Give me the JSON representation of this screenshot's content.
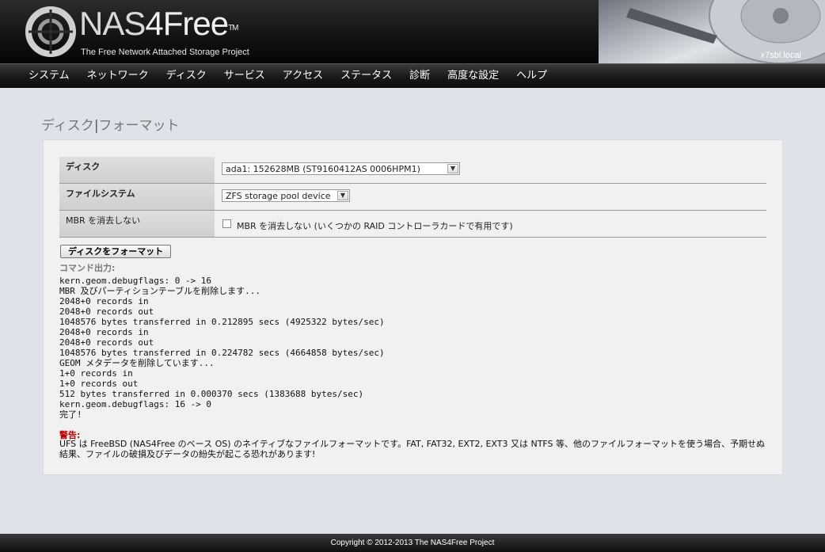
{
  "header": {
    "brand_nas": "NAS",
    "brand_rest": "4Free",
    "trademark": "TM",
    "tagline": "The Free Network Attached Storage Project",
    "hostname": "x7sbl.local"
  },
  "nav": {
    "items": [
      "システム",
      "ネットワーク",
      "ディスク",
      "サービス",
      "アクセス",
      "ステータス",
      "診断",
      "高度な設定",
      "ヘルプ"
    ]
  },
  "page": {
    "title_section": "ディスク",
    "title_separator": "|",
    "title_page": "フォーマット"
  },
  "form": {
    "disk_label": "ディスク",
    "disk_value": "ada1: 152628MB (ST9160412AS 0006HPM1)",
    "fs_label": "ファイルシステム",
    "fs_value": "ZFS storage pool device",
    "mbr_label": "MBR を消去しない",
    "mbr_checkbox_label": "MBR を消去しない (いくつかの RAID コントローラカードで有用です)",
    "mbr_checked": false,
    "format_button": "ディスクをフォーマット"
  },
  "output": {
    "label": "コマンド出力:",
    "text": "kern.geom.debugflags: 0 -> 16\nMBR 及びパーティションテーブルを削除します...\n2048+0 records in\n2048+0 records out\n1048576 bytes transferred in 0.212895 secs (4925322 bytes/sec)\n2048+0 records in\n2048+0 records out\n1048576 bytes transferred in 0.224782 secs (4664858 bytes/sec)\nGEOM メタデータを削除しています...\n1+0 records in\n1+0 records out\n512 bytes transferred in 0.000370 secs (1383688 bytes/sec)\nkern.geom.debugflags: 16 -> 0\n完了!"
  },
  "warning": {
    "title": "警告:",
    "text": "UFS は FreeBSD (NAS4Free のベース OS) のネイティブなファイルフォーマットです。FAT, FAT32, EXT2, EXT3 又は NTFS 等、他のファイルフォーマットを使う場合、予期せぬ結果、ファイルの破損及びデータの紛失が起こる恐れがあります!"
  },
  "footer": {
    "copyright": "Copyright © 2012-2013 The NAS4Free Project"
  },
  "colors": {
    "warning": "#c00000",
    "background": "#dfe2e8",
    "panel": "#f1f1f1"
  }
}
